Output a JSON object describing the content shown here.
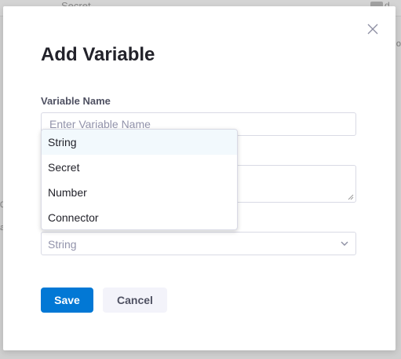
{
  "background": {
    "top_text": "Secret",
    "right_text": "d",
    "left_marks": [
      "0",
      "a"
    ],
    "right_mark": "o"
  },
  "modal": {
    "title": "Add Variable",
    "name_label": "Variable Name",
    "name_placeholder": "Enter Variable Name",
    "type_value": "String",
    "menu_items": [
      "String",
      "Secret",
      "Number",
      "Connector"
    ],
    "active_item": "String",
    "save_label": "Save",
    "cancel_label": "Cancel",
    "close_icon": "close-icon"
  },
  "colors": {
    "primary": "#0278d5",
    "title": "#22222a",
    "label": "#4f5162",
    "placeholder": "#9293ab",
    "menu_active": "#f2f9fd"
  }
}
